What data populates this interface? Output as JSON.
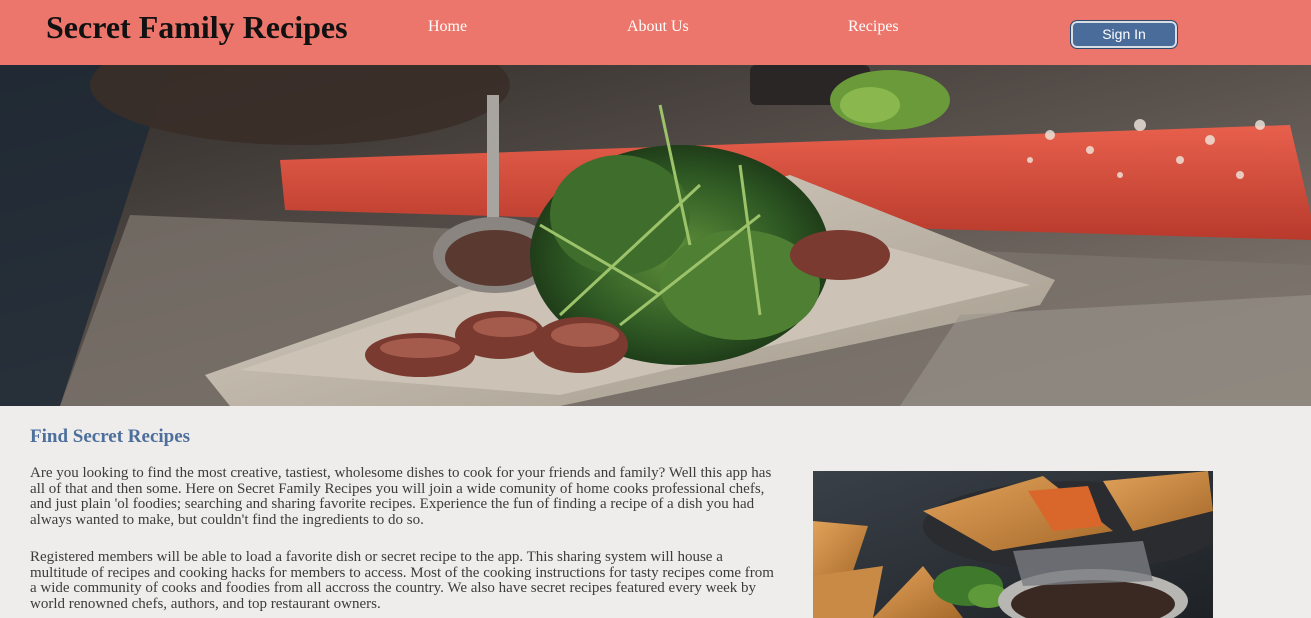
{
  "header": {
    "brand": "Secret Family Recipes",
    "nav": {
      "home": "Home",
      "about": "About Us",
      "recipes": "Recipes"
    },
    "signin_label": "Sign In"
  },
  "colors": {
    "header_bg": "#ec766b",
    "button_bg": "#4a6c9a",
    "title_color": "#4d6f9c",
    "page_bg": "#eeedeb"
  },
  "main": {
    "title": "Find Secret Recipes",
    "paragraphs": [
      "Are you looking to find the most creative, tastiest, wholesome dishes to cook for your friends and family? Well this app has all of that and then some. Here on Secret Family Recipes you will join a wide comunity of home cooks professional chefs, and just plain 'ol foodies; searching and sharing favorite recipes. Experience the fun of finding a recipe of a dish you had always wanted to make, but couldn't find the ingredients to do so.",
      "Registered members will be able to load a favorite dish or secret recipe to the app. This sharing system will house a multitude of recipes and cooking hacks for members to access. Most of the cooking instructions for tasty recipes come from a wide community of cooks and foodies from all accross the country. We also have secret recipes featured every week by world renowned chefs, authors, and top restaurant owners."
    ]
  }
}
